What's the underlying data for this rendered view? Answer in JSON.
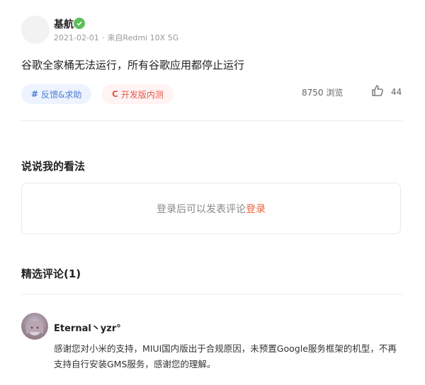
{
  "post": {
    "author": "基航",
    "date": "2021-02-01",
    "separator": "·",
    "source": "来自Redmi 10X 5G",
    "title": "谷歌全家桶无法运行，所有谷歌应用都停止运行",
    "tags": [
      {
        "label": "反馈&求助",
        "icon": "#"
      },
      {
        "label": "开发版内测",
        "icon": "C"
      }
    ],
    "views": "8750 浏览",
    "likes": "44"
  },
  "comment_section": {
    "title": "说说我的看法",
    "login_prompt": "登录后可以发表评论",
    "login_link": "登录"
  },
  "featured": {
    "title": "精选评论(1)",
    "comments": [
      {
        "user": "Eternal丶yzr°",
        "text": "感谢您对小米的支持，MIUI国内版出于合规原因，未预置Google服务框架的机型，不再支持自行安装GMS服务，感谢您的理解。"
      }
    ]
  },
  "colors": {
    "accent": "#e8643c",
    "tag_blue": "#4a7bd0",
    "tag_red": "#e45b4b",
    "badge_green": "#5cbf5a"
  }
}
